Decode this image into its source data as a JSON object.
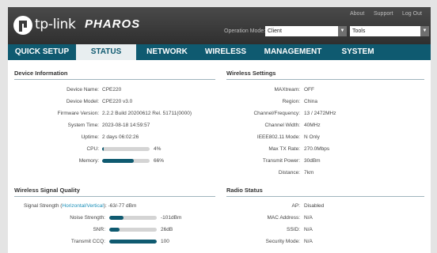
{
  "header": {
    "brand": "tp-link",
    "product": "PHAROS",
    "links": [
      "About",
      "Support",
      "Log Out"
    ],
    "operation_mode_label": "Operation Mode:",
    "operation_mode_value": "Client",
    "tools_value": "Tools"
  },
  "nav": {
    "tabs": [
      {
        "label": "QUICK SETUP",
        "active": false
      },
      {
        "label": "STATUS",
        "active": true
      },
      {
        "label": "NETWORK",
        "active": false
      },
      {
        "label": "WIRELESS",
        "active": false
      },
      {
        "label": "MANAGEMENT",
        "active": false
      },
      {
        "label": "SYSTEM",
        "active": false
      }
    ]
  },
  "device_info": {
    "title": "Device Information",
    "device_name_label": "Device Name:",
    "device_name": "CPE220",
    "device_model_label": "Device Model:",
    "device_model": "CPE220 v3.0",
    "firmware_label": "Firmware Version:",
    "firmware": "2.2.2 Build 20200612 Rel. 51711(0000)",
    "system_time_label": "System Time:",
    "system_time": "2023-08-18 14:59:57",
    "uptime_label": "Uptime:",
    "uptime": "2 days 06:02:26",
    "cpu_label": "CPU:",
    "cpu_text": "4%",
    "cpu_fraction": 0.04,
    "memory_label": "Memory:",
    "memory_text": "66%",
    "memory_fraction": 0.66
  },
  "wireless_settings": {
    "title": "Wireless Settings",
    "maxtream_label": "MAXtream:",
    "maxtream": "OFF",
    "region_label": "Region:",
    "region": "China",
    "channel_label": "Channel/Frequency:",
    "channel": "13 / 2472MHz",
    "width_label": "Channel Width:",
    "width": "40MHz",
    "mode_label": "IEEE802.11 Mode:",
    "mode": "N Only",
    "rate_label": "Max TX Rate:",
    "rate": "270.0Mbps",
    "power_label": "Transmit Power:",
    "power": "30dBm",
    "distance_label": "Distance:",
    "distance": "7km"
  },
  "signal_quality": {
    "title": "Wireless Signal Quality",
    "strength_prefix": "Signal Strength (",
    "strength_link": "Horizontal/Vertical",
    "strength_suffix": "):",
    "strength_value": "-63/-77 dBm",
    "noise_label": "Noise Strength:",
    "noise": "-101dBm",
    "noise_fraction": 0.3,
    "snr_label": "SNR:",
    "snr": "26dB",
    "snr_fraction": 0.22,
    "ccq_label": "Transmit CCQ:",
    "ccq": "100",
    "ccq_fraction": 1.0
  },
  "radio_status": {
    "title": "Radio Status",
    "ap_label": "AP:",
    "ap": "Disabled",
    "mac_label": "MAC Address:",
    "mac": "N/A",
    "ssid_label": "SSID:",
    "ssid": "N/A",
    "security_label": "Security Mode:",
    "security": "N/A"
  }
}
